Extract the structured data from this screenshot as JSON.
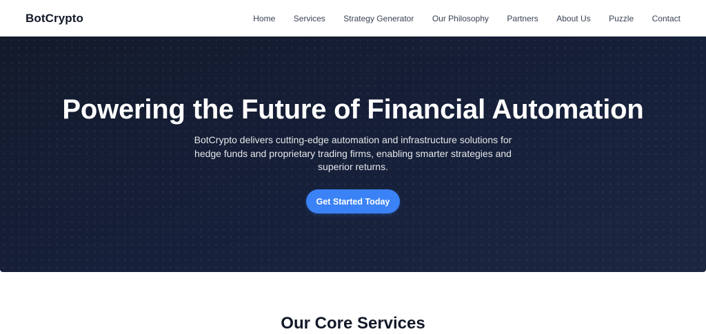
{
  "navbar": {
    "brand": "BotCrypto",
    "links": [
      {
        "label": "Home"
      },
      {
        "label": "Services"
      },
      {
        "label": "Strategy Generator"
      },
      {
        "label": "Our Philosophy"
      },
      {
        "label": "Partners"
      },
      {
        "label": "About Us"
      },
      {
        "label": "Puzzle"
      },
      {
        "label": "Contact"
      }
    ]
  },
  "hero": {
    "title": "Powering the Future of Financial Automation",
    "description": "BotCrypto delivers cutting-edge automation and infrastructure solutions for hedge funds and proprietary trading firms, enabling smarter strategies and superior returns.",
    "cta_label": "Get Started Today"
  },
  "services": {
    "title": "Our Core Services"
  },
  "colors": {
    "hero_background": "#16203a",
    "accent": "#3b82f6",
    "text_dark": "#111827"
  }
}
